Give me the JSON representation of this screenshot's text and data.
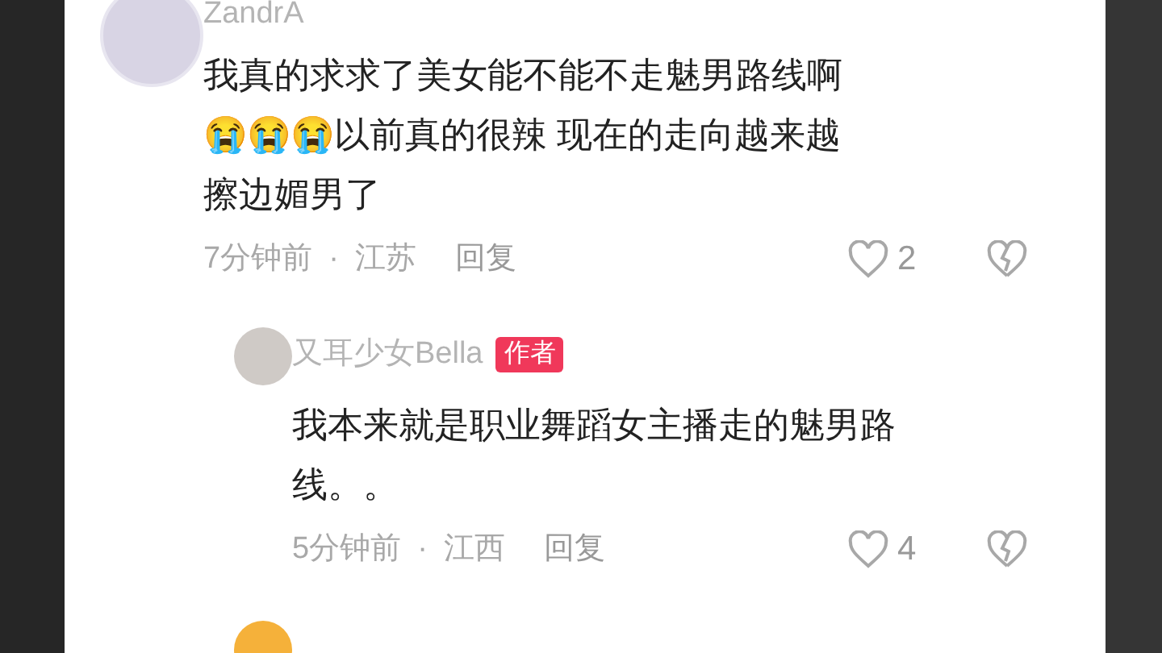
{
  "comments": [
    {
      "author": "ZandrA",
      "lines": [
        "我真的求求了美女能不能不走魅男路线啊",
        "😭😭😭以前真的很辣 现在的走向越来越",
        "擦边媚男了"
      ],
      "time": "7分钟前",
      "separator": "·",
      "location": "江苏",
      "reply": "回复",
      "likes": "2",
      "kind": "top"
    },
    {
      "author": "又耳少女Bella",
      "author_badge": "作者",
      "lines": [
        "我本来就是职业舞蹈女主播走的魅男路",
        "线。。"
      ],
      "time": "5分钟前",
      "separator": "·",
      "location": "江西",
      "reply": "回复",
      "likes": "4",
      "kind": "reply"
    }
  ]
}
